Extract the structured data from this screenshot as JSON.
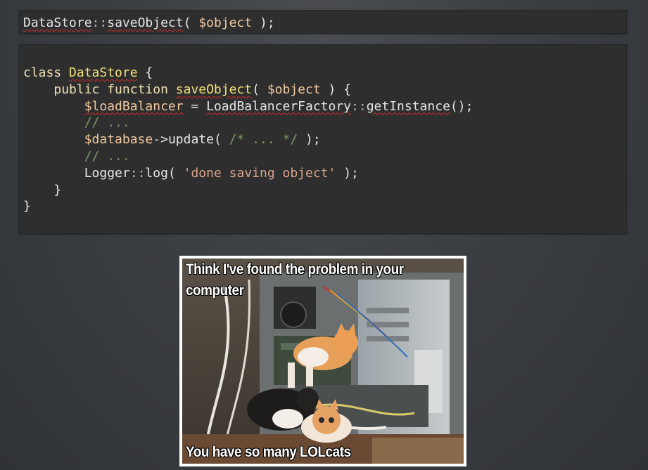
{
  "snippet_one": {
    "cls": "DataStore",
    "sep": "::",
    "method": "saveObject",
    "open": "( ",
    "arg": "$object",
    "close": " );"
  },
  "snippet_two": {
    "l1_kw": "class ",
    "l1_name": "DataStore",
    "l1_brace": " {",
    "l2_indent": "    ",
    "l2_kw": "public function ",
    "l2_name": "saveObject",
    "l2_open": "( ",
    "l2_arg": "$object",
    "l2_close": " ) {",
    "l3_indent": "        ",
    "l3_var": "$loadBalancer",
    "l3_eq": " = ",
    "l3_cls": "LoadBalancerFactory",
    "l3_sep": "::",
    "l3_call": "getInstance",
    "l3_end": "();",
    "l4_indent": "        ",
    "l4_comment": "// ...",
    "l5_indent": "        ",
    "l5_var": "$database",
    "l5_arrow": "->",
    "l5_call": "update",
    "l5_open": "( ",
    "l5_comment": "/* ... */",
    "l5_close": " );",
    "l6_indent": "        ",
    "l6_comment": "// ...",
    "l7_indent": "        ",
    "l7_cls": "Logger",
    "l7_sep": "::",
    "l7_call": "log",
    "l7_open": "( ",
    "l7_str": "'done saving object'",
    "l7_close": " );",
    "l8": "    }",
    "l9": "}"
  },
  "meme": {
    "caption_top_line1": "Think I've found the problem in your",
    "caption_top_line2": "computer",
    "caption_bottom": "You have so many LOLcats"
  },
  "colors": {
    "keyword": "#f0e2b6",
    "class_name": "#f2e27a",
    "variable": "#f2c9a0",
    "comment": "#7c9a6a",
    "string": "#d9a48a",
    "spellcheck": "#cc2b2b"
  }
}
